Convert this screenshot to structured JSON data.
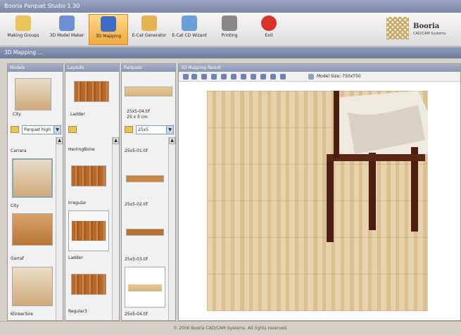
{
  "window": {
    "title": "Booria Parquet Studio 1.30"
  },
  "toolbar": {
    "items": [
      {
        "label": "Making Groups",
        "icon": "folder-group-icon",
        "color": "#e8c55a"
      },
      {
        "label": "3D Model Maker",
        "icon": "cube-gear-icon",
        "color": "#6f8fd0"
      },
      {
        "label": "3D Mapping",
        "icon": "gear-icon",
        "color": "#3b6fc7",
        "active": true
      },
      {
        "label": "E-Cat Generator",
        "icon": "document-gear-icon",
        "color": "#e3b44f"
      },
      {
        "label": "E-Cat CD Wizard",
        "icon": "cd-wizard-icon",
        "color": "#6aa0d8"
      },
      {
        "label": "Printing",
        "icon": "printer-icon",
        "color": "#888888"
      },
      {
        "label": "Exit",
        "icon": "close-circle-icon",
        "color": "#d9322b"
      }
    ]
  },
  "brand": {
    "name": "Booria",
    "tagline": "CAD/CAM Systems"
  },
  "section": {
    "title": "3D Mapping ..."
  },
  "models": {
    "header": "Models",
    "selected": "City",
    "filter": "Parquet high",
    "items": [
      "Carrara",
      "City",
      "Garraf",
      "KlinkerSire"
    ]
  },
  "layouts": {
    "header": "Layouts",
    "selected": "Ladder",
    "items": [
      "HerringBone",
      "Irregular",
      "Ladder",
      "Regular3"
    ]
  },
  "parquets": {
    "header": "Parquets",
    "selected": "25x5-04.tif",
    "selected_size": "25 x 5 cm",
    "filter": "25x5",
    "items": [
      "25x5-01.tif",
      "25x5-02.tif",
      "25x5-03.tif",
      "25x5-04.tif"
    ]
  },
  "result": {
    "header": "3D Mapping Result",
    "model_size_label": "Model Size: 750x750"
  },
  "footer": {
    "copyright": "© 2006 Booria CAD/CAM Systems. All rights reserved."
  }
}
